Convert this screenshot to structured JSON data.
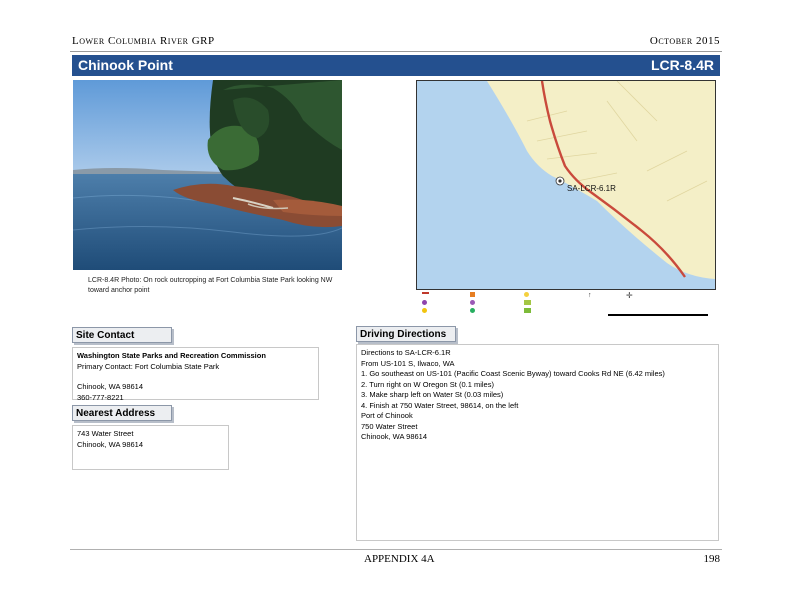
{
  "header": {
    "left_title": "Lower Columbia River GRP",
    "right_date": "October 2015"
  },
  "title_bar": {
    "site_name": "Chinook Point",
    "site_code": "LCR-8.4R"
  },
  "photo": {
    "caption": "LCR-8.4R Photo: On rock outcropping at Fort Columbia State Park looking NW toward anchor point"
  },
  "map": {
    "site_label": "SA-LCR-6.1R",
    "legend_items": [
      {
        "label": "",
        "color": "#c0392b"
      },
      {
        "label": "",
        "color": "#8e44ad"
      },
      {
        "label": "",
        "color": "#f1c40f"
      },
      {
        "label": "",
        "color": "#e67e22"
      },
      {
        "label": "",
        "color": "#9b59b6"
      },
      {
        "label": "",
        "color": "#27ae60"
      },
      {
        "label": "",
        "color": "#f4d03f"
      },
      {
        "label": "",
        "color": "#a3c644"
      },
      {
        "label": "",
        "color": "#7dbb3a"
      }
    ],
    "colors": {
      "water": "#b3d3ee",
      "land": "#f4efc7",
      "road": "#c94a3c"
    }
  },
  "site_contact": {
    "heading": "Site Contact",
    "org": "Washington State Parks and Recreation Commission",
    "primary": "Primary Contact: Fort Columbia State Park",
    "city": "Chinook, WA 98614",
    "phone": "360-777-8221"
  },
  "nearest_address": {
    "heading": "Nearest Address",
    "line1": "743 Water Street",
    "line2": "Chinook, WA 98614"
  },
  "driving_directions": {
    "heading": "Driving Directions",
    "lines": [
      "Directions to SA-LCR-6.1R",
      "From US-101 S, Ilwaco, WA",
      "1. Go southeast on US-101 (Pacific Coast Scenic Byway) toward Cooks Rd NE (6.42 miles)",
      "2. Turn right on W Oregon St (0.1 miles)",
      "3. Make sharp left on Water St (0.03 miles)",
      "4. Finish at 750 Water Street, 98614, on the left",
      "Port of Chinook",
      "750 Water Street",
      "Chinook, WA 98614"
    ]
  },
  "footer": {
    "appendix": "APPENDIX 4A",
    "page": "198"
  }
}
